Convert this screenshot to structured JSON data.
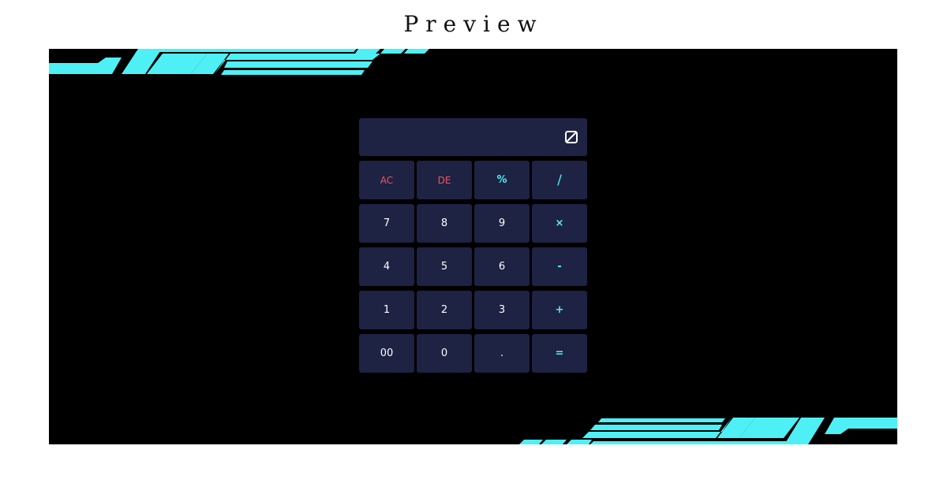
{
  "page": {
    "title": "Preview"
  },
  "colors": {
    "stage_background": "#000000",
    "panel": "#1e2243",
    "accent_cyan": "#4ef0f5",
    "accent_red": "#f2545b",
    "text": "#ffffff"
  },
  "display": {
    "value": "",
    "toggle_icon": "slash-square-icon"
  },
  "keys": [
    {
      "label": "AC",
      "style": "red",
      "name": "key-all-clear"
    },
    {
      "label": "DE",
      "style": "red",
      "name": "key-delete"
    },
    {
      "label": "%",
      "style": "cyan",
      "name": "key-percent"
    },
    {
      "label": "/",
      "style": "cyan big",
      "name": "key-divide"
    },
    {
      "label": "7",
      "style": "",
      "name": "key-7"
    },
    {
      "label": "8",
      "style": "",
      "name": "key-8"
    },
    {
      "label": "9",
      "style": "",
      "name": "key-9"
    },
    {
      "label": "×",
      "style": "cyan",
      "name": "key-multiply"
    },
    {
      "label": "4",
      "style": "",
      "name": "key-4"
    },
    {
      "label": "5",
      "style": "",
      "name": "key-5"
    },
    {
      "label": "6",
      "style": "",
      "name": "key-6"
    },
    {
      "label": "-",
      "style": "cyan",
      "name": "key-subtract"
    },
    {
      "label": "1",
      "style": "",
      "name": "key-1"
    },
    {
      "label": "2",
      "style": "",
      "name": "key-2"
    },
    {
      "label": "3",
      "style": "",
      "name": "key-3"
    },
    {
      "label": "+",
      "style": "cyan",
      "name": "key-add"
    },
    {
      "label": "00",
      "style": "",
      "name": "key-double-zero"
    },
    {
      "label": "0",
      "style": "",
      "name": "key-0"
    },
    {
      "label": ".",
      "style": "",
      "name": "key-decimal"
    },
    {
      "label": "=",
      "style": "cyan",
      "name": "key-equals"
    }
  ]
}
